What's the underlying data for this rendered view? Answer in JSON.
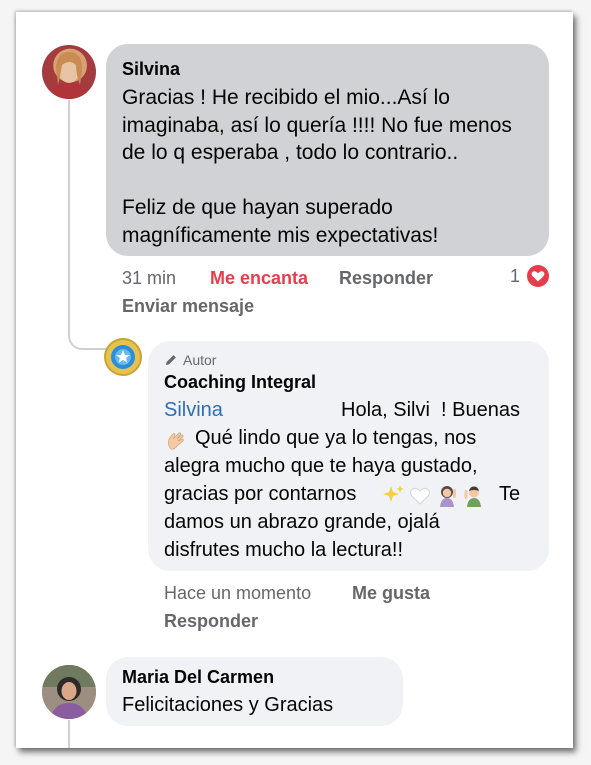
{
  "colors": {
    "bubble_gray": "#d0d2d6",
    "bubble_light": "#f0f2f5",
    "love_red": "#e83c4d",
    "mention_blue": "#2f6db5",
    "meta_gray": "#65676b"
  },
  "comments": [
    {
      "author": "Silvina",
      "text": "Gracias ! He recibido el mio...Así lo\nimaginaba, así lo quería !!!! No fue menos\nde lo q esperaba , todo lo contrario..\n\nFeliz de que hayan superado\nmagníficamente mis expectativas!",
      "time": "31 min",
      "reaction_label": "Me encanta",
      "reply_label": "Responder",
      "reaction_count": "1",
      "reaction_icon": "heart-icon",
      "send_message_label": "Enviar mensaje"
    },
    {
      "badge_icon": "pencil-icon",
      "badge_label": "Autor",
      "author": "Coaching Integral",
      "mention": "Silvina",
      "line1_rest": "Hola, Silvi  ! Buenas",
      "line2": "Qué lindo que ya lo tengas, nos",
      "line3": "alegra mucho que te haya gustado,",
      "line4": "gracias por contarnos",
      "line4_end": "Te",
      "line5": "damos un abrazo grande, ojalá",
      "line6": "disfrutes mucho la lectura!!",
      "time": "Hace un momento",
      "like_label": "Me gusta",
      "reply_label": "Responder"
    },
    {
      "author": "Maria Del Carmen",
      "text": "Felicitaciones y Gracias"
    }
  ]
}
